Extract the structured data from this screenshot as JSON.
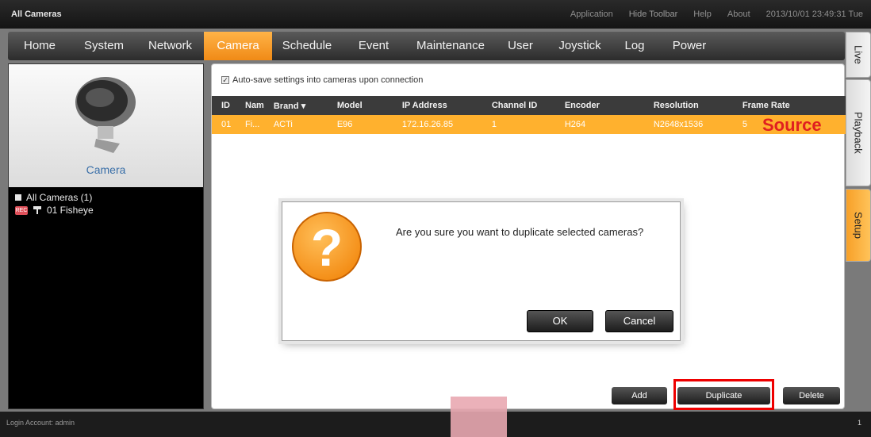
{
  "window": {
    "title": "All Cameras"
  },
  "toplinks": [
    "Application",
    "Hide Toolbar",
    "Help",
    "About",
    "2013/10/01 23:49:31 Tue"
  ],
  "nav": [
    {
      "label": "Home"
    },
    {
      "label": "System"
    },
    {
      "label": "Network"
    },
    {
      "label": "Camera",
      "active": true
    },
    {
      "label": "Schedule"
    },
    {
      "label": "Event"
    },
    {
      "label": "Maintenance"
    },
    {
      "label": "User"
    },
    {
      "label": "Joystick"
    },
    {
      "label": "Log"
    },
    {
      "label": "Power"
    }
  ],
  "side_tabs": [
    "Live",
    "Playback",
    "Setup"
  ],
  "left": {
    "camera_label": "Camera",
    "tree_root": "All Cameras (1)",
    "tree_item": "01  Fisheye",
    "tree_badge": "REC"
  },
  "main": {
    "autosave": "Auto-save settings into cameras upon connection",
    "columns": [
      "ID",
      "Nam",
      "Brand",
      "Model",
      "IP Address",
      "Channel ID",
      "Encoder",
      "Resolution",
      "Frame Rate"
    ],
    "rows": [
      [
        "01",
        "Fi...",
        "ACTi",
        "E96",
        "172.16.26.85",
        "1",
        "H264",
        "N2648x1536",
        "5"
      ]
    ],
    "source_label": "Source"
  },
  "dialog": {
    "message": "Are you sure you want to duplicate selected cameras?",
    "ok": "OK",
    "cancel": "Cancel",
    "icon_glyph": "?"
  },
  "buttons": {
    "add": "Add",
    "duplicate": "Duplicate",
    "delete": "Delete"
  },
  "status": {
    "account": "Login Account: admin",
    "count": "1"
  },
  "colors": {
    "accent": "#f7a028",
    "row_highlight": "#ffb12e",
    "source_red": "#e02020",
    "highlight_box": "#e00000"
  }
}
